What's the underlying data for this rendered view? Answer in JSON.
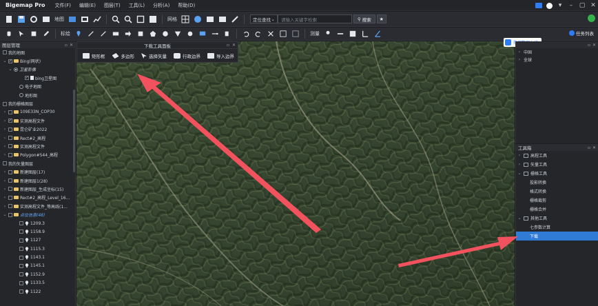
{
  "app": {
    "name": "Bigemap Pro"
  },
  "menu": [
    "文件(F)",
    "编辑(E)",
    "图层(T)",
    "工具(L)",
    "分析(A)",
    "帮助(D)"
  ],
  "toolbar1": {
    "map_label": "地图",
    "grid_label": "网格",
    "locate_label": "定位查找",
    "search_placeholder": "请输入关键字检索",
    "search_button": "搜索"
  },
  "toolbar2": {
    "mark_label": "标绘",
    "measure_label": "测量",
    "task_list": "任务列表"
  },
  "left_panel": {
    "title": "图层管理",
    "rows": [
      {
        "type": "section",
        "label": "我的地图",
        "checked": false
      },
      {
        "type": "folder",
        "label": "Bing(网状)",
        "checked": true,
        "chev": "⌄",
        "indent": 4
      },
      {
        "type": "radio",
        "label": "卫星影像",
        "on": true,
        "chev": "⌄",
        "indent": 12,
        "italic": true
      },
      {
        "type": "doc",
        "label": "bing卫星图",
        "checked": true,
        "indent": 28
      },
      {
        "type": "radio",
        "label": "电子地图",
        "on": false,
        "indent": 20
      },
      {
        "type": "radio",
        "label": "地形图",
        "on": false,
        "indent": 20
      },
      {
        "type": "section",
        "label": "我的栅格图层",
        "checked": false
      },
      {
        "type": "folder",
        "label": "109E33N_COP30",
        "checked": false,
        "chev": "›",
        "indent": 4
      },
      {
        "type": "folder",
        "label": "实测高程文件",
        "checked": true,
        "chev": "›",
        "indent": 4
      },
      {
        "type": "folder",
        "label": "昆仑矿业2022",
        "checked": false,
        "chev": "›",
        "indent": 4
      },
      {
        "type": "folder",
        "label": "Rect#2_高程",
        "checked": false,
        "chev": "›",
        "indent": 4
      },
      {
        "type": "folder",
        "label": "实测高程文件",
        "checked": false,
        "chev": "›",
        "indent": 4
      },
      {
        "type": "folder",
        "label": "Polygon#544_高程",
        "checked": false,
        "chev": "›",
        "indent": 4
      },
      {
        "type": "section",
        "label": "我的矢量图层",
        "checked": false
      },
      {
        "type": "folder",
        "label": "新建图层(17)",
        "checked": false,
        "chev": "›",
        "indent": 4
      },
      {
        "type": "folder",
        "label": "新建图层1(28)",
        "checked": false,
        "chev": "›",
        "indent": 4
      },
      {
        "type": "folder",
        "label": "新建图层_生成坐标(15)",
        "checked": false,
        "chev": "›",
        "indent": 4
      },
      {
        "type": "folder",
        "label": "Rect#2_高程_Level_16...",
        "checked": false,
        "chev": "›",
        "indent": 4
      },
      {
        "type": "folder",
        "label": "实测高程文件_等高线(1...",
        "checked": false,
        "chev": "›",
        "indent": 4
      },
      {
        "type": "folder",
        "label": "点位信息(48)",
        "checked": false,
        "chev": "⌄",
        "indent": 4,
        "accent": true
      },
      {
        "type": "pin",
        "label": "1209.3",
        "checked": false,
        "indent": 20
      },
      {
        "type": "pin",
        "label": "1158.9",
        "checked": false,
        "indent": 20
      },
      {
        "type": "pin",
        "label": "1127",
        "checked": false,
        "indent": 20
      },
      {
        "type": "pin",
        "label": "1115.3",
        "checked": false,
        "indent": 20
      },
      {
        "type": "pin",
        "label": "1143.1",
        "checked": false,
        "indent": 20
      },
      {
        "type": "pin",
        "label": "1145.1",
        "checked": false,
        "indent": 20
      },
      {
        "type": "pin",
        "label": "1152.9",
        "checked": false,
        "indent": 20
      },
      {
        "type": "pin",
        "label": "1133.5",
        "checked": false,
        "indent": 20
      },
      {
        "type": "pin",
        "label": "1122",
        "checked": false,
        "indent": 20
      }
    ]
  },
  "download_panel": {
    "title": "下载工具面板",
    "buttons": [
      {
        "label": "矩形框",
        "icon": "rectangle-icon"
      },
      {
        "label": "多边形",
        "icon": "polygon-icon"
      },
      {
        "label": "选择矢量",
        "icon": "select-arrow-icon"
      },
      {
        "label": "行政边界",
        "icon": "boundary-icon"
      },
      {
        "label": "导入边界",
        "icon": "import-icon"
      }
    ]
  },
  "hot_data": {
    "label": "热搜数据上线"
  },
  "right_top": {
    "items": [
      "中国",
      "全球"
    ]
  },
  "tool_box": {
    "title": "工具箱",
    "groups": [
      {
        "label": "高程工具",
        "expanded": false,
        "children": []
      },
      {
        "label": "矢量工具",
        "expanded": false,
        "children": []
      },
      {
        "label": "栅格工具",
        "expanded": true,
        "children": [
          "投影转换",
          "格式转换",
          "栅格裁剪",
          "栅格合并"
        ]
      },
      {
        "label": "其他工具",
        "expanded": true,
        "children": [
          "七参数计算",
          "下载"
        ]
      }
    ],
    "selected": "下载"
  },
  "colors": {
    "accent": "#2f7bd6",
    "arrow": "#f2525e"
  }
}
